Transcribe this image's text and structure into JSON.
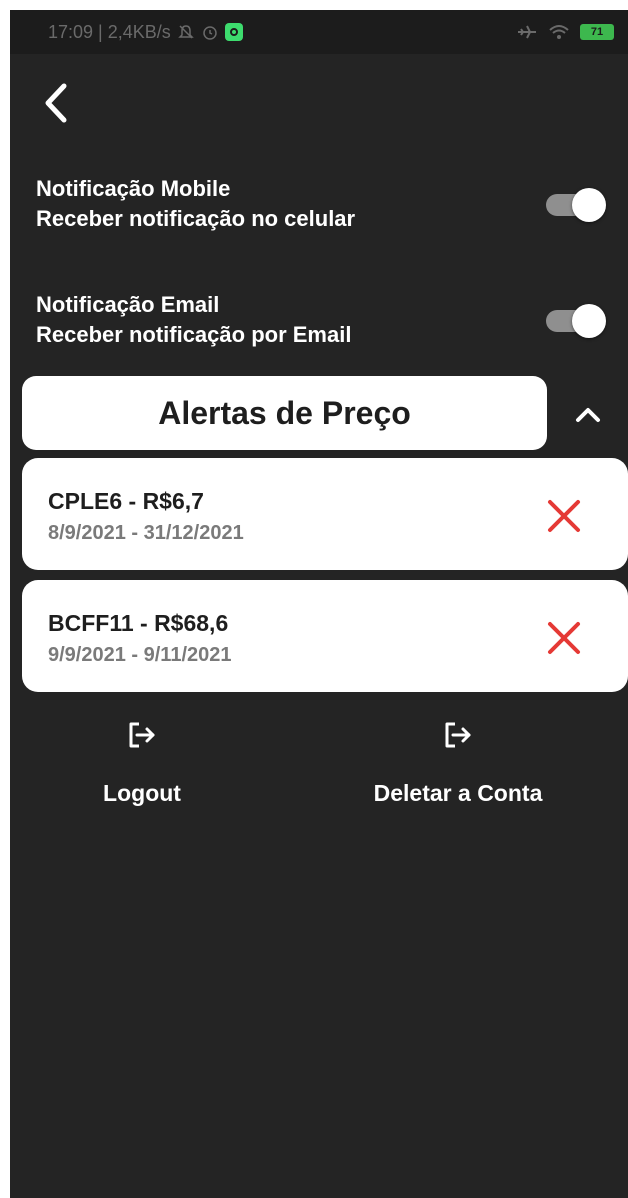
{
  "status_bar": {
    "time_speed": "17:09 | 2,4KB/s",
    "battery": "71"
  },
  "settings": {
    "mobile": {
      "title": "Notificação Mobile",
      "subtitle": "Receber notificação no celular",
      "enabled": true
    },
    "email": {
      "title": "Notificação Email",
      "subtitle": "Receber notificação por Email",
      "enabled": true
    }
  },
  "price_alerts": {
    "title": "Alertas de Preço",
    "items": [
      {
        "title": "CPLE6 - R$6,7",
        "dates": "8/9/2021 - 31/12/2021"
      },
      {
        "title": "BCFF11 - R$68,6",
        "dates": "9/9/2021 - 9/11/2021"
      }
    ]
  },
  "actions": {
    "logout": "Logout",
    "delete_account": "Deletar a Conta"
  },
  "colors": {
    "background": "#242424",
    "card": "#ffffff",
    "delete": "#e53935",
    "toggle_track": "#8f8f8f"
  },
  "icons": {
    "back": "chevron-left-icon",
    "collapse": "chevron-up-icon",
    "delete": "close-icon",
    "logout": "logout-icon",
    "delete_account": "logout-icon"
  }
}
